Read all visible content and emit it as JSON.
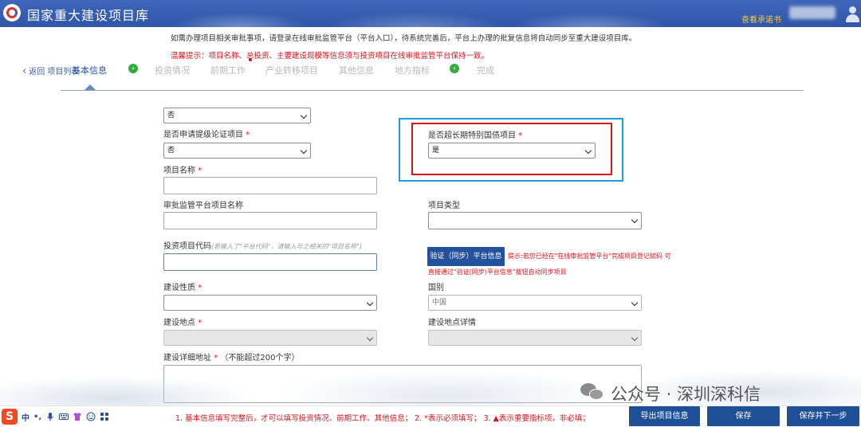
{
  "header": {
    "app_title": "国家重大建设项目库",
    "commitment_link": "查看承诺书"
  },
  "notices": {
    "line1": "如需办理项目相关审批事项，请登录在线审批监管平台（平台入口），待系统完善后，平台上办理的批复信息将自动同步至重大建设项目库。",
    "line2": "温馨提示：项目名称、总投资、主要建设规模等信息须与投资项目在线审批监管平台保持一致。"
  },
  "steps": {
    "back_label": "返回 项目列表",
    "items": [
      "基本信息",
      "投资情况",
      "前期工作",
      "产业转移项目",
      "其他信息",
      "地方指标",
      "完成"
    ]
  },
  "form": {
    "field_cut": {
      "value": "否"
    },
    "upgrade_demo": {
      "label": "是否申请提级论证项目",
      "value": "否"
    },
    "ultra_long_bond": {
      "label": "是否超长期特别国债项目",
      "value": "是"
    },
    "project_name": {
      "label": "项目名称",
      "value": ""
    },
    "platform_project_name": {
      "label": "审批监管平台项目名称",
      "value": ""
    },
    "project_type": {
      "label": "项目类型",
      "value": ""
    },
    "investment_code": {
      "label": "投资项目代码",
      "hint": "(若输入了\"平台代码\"，请输入与之相关的\"项目名称\")",
      "value": ""
    },
    "verify_button": "验证（同步）平台信息",
    "verify_hint_line1": "提示:若您已经在\"在线审批监管平台\"完成项目登记赋码 可",
    "verify_hint_line2": "直接通过\"验证(同步)平台信息\"按钮自动同步项目",
    "construction_nature": {
      "label": "建设性质",
      "value": ""
    },
    "country": {
      "label": "国别",
      "value": "中国"
    },
    "location": {
      "label": "建设地点",
      "value": ""
    },
    "location_detail": {
      "label": "建设地点详情",
      "value": ""
    },
    "address": {
      "label": "建设详细地址",
      "note": "（不能超过200个字）",
      "value": ""
    },
    "required_mark": "*"
  },
  "watermark": "公众号 · 深圳深科信",
  "ime": {
    "logo": "S",
    "lang": "中",
    "punct": "•,"
  },
  "footer": {
    "note": "1. 基本信息填写完整后，才可以填写投资情况、前期工作、其他信息；  2. *表示必须填写；  3. ▲表示重要指标项，非必填；",
    "export_button": "导出项目信息",
    "save_button": "保存",
    "save_next_button": "保存并下一步"
  },
  "colors": {
    "header_bg": "#2f56a8",
    "accent_blue": "#1f4f97",
    "required_red": "#d8151d",
    "complete_green": "#35ad3b",
    "link_gold": "#f1c94a"
  }
}
